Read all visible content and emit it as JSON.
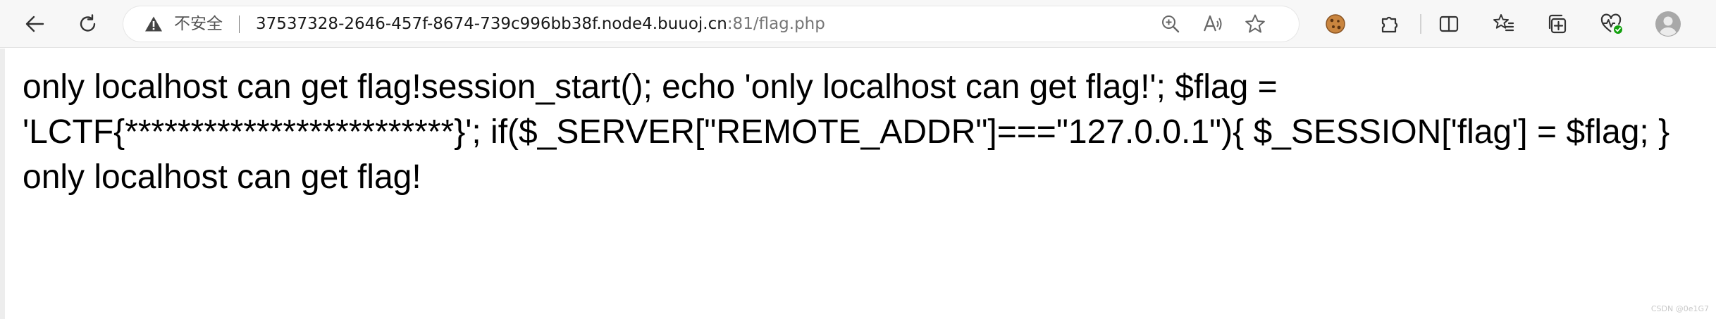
{
  "browser": {
    "security_label": "不安全",
    "url_host": "37537328-2646-457f-8674-739c996bb38f.node4.buuoj.cn",
    "url_port_path": ":81/flag.php",
    "icons": {
      "back": "back-arrow-icon",
      "reload": "reload-icon",
      "warning": "warning-icon",
      "zoom": "zoom-icon",
      "read_aloud": "read-aloud-icon",
      "favorite": "star-icon",
      "cookie": "cookie-icon",
      "extensions": "puzzle-icon",
      "split": "split-screen-icon",
      "favorites": "favorites-icon",
      "collections": "collections-icon",
      "health": "browser-essentials-icon",
      "profile": "profile-icon"
    }
  },
  "page": {
    "body_text": "only localhost can get flag!session_start(); echo 'only localhost can get flag!'; $flag = 'LCTF{*************************}'; if($_SERVER[\"REMOTE_ADDR\"]===\"127.0.0.1\"){ $_SESSION['flag'] = $flag; } only localhost can get flag!"
  },
  "watermark": "CSDN @0e1G7"
}
